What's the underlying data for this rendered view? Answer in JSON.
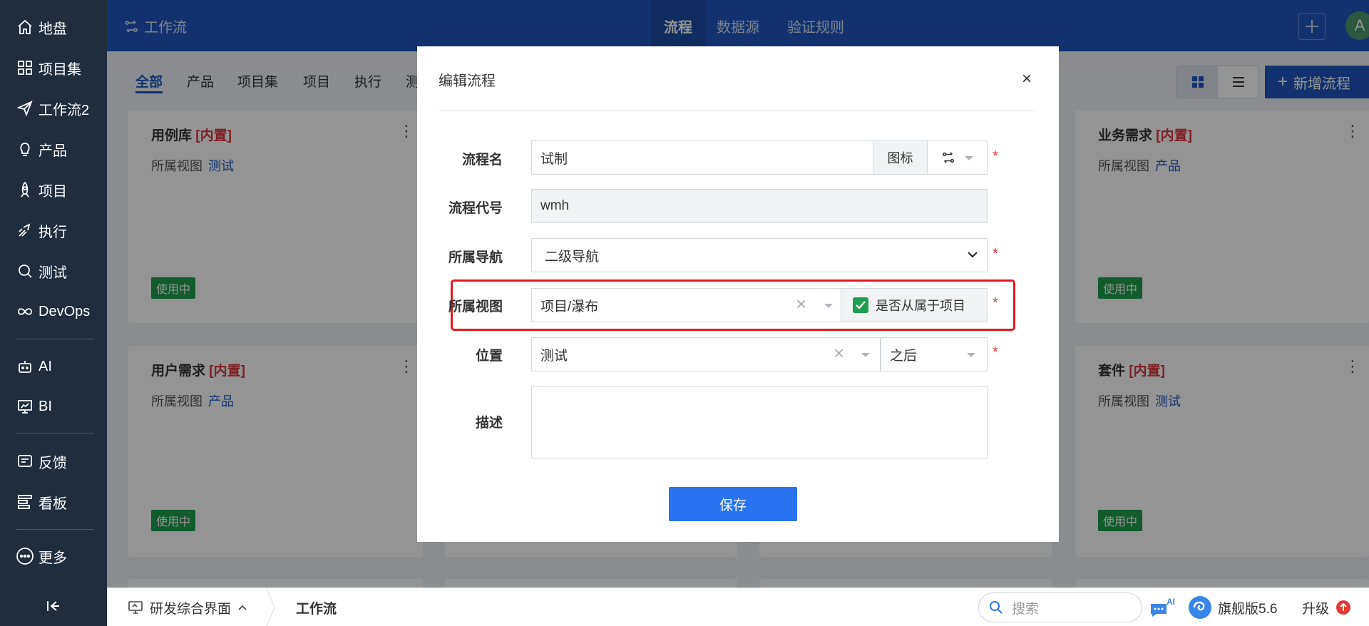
{
  "sidebar": {
    "items": [
      {
        "label": "地盘",
        "icon": "home-icon"
      },
      {
        "label": "项目集",
        "icon": "grid-icon"
      },
      {
        "label": "工作流2",
        "icon": "paper-plane-icon"
      },
      {
        "label": "产品",
        "icon": "lightbulb-icon"
      },
      {
        "label": "项目",
        "icon": "rocket-icon"
      },
      {
        "label": "执行",
        "icon": "run-icon"
      },
      {
        "label": "测试",
        "icon": "magnifier-icon"
      },
      {
        "label": "DevOps",
        "icon": "infinity-icon"
      },
      {
        "label": "AI",
        "icon": "robot-icon"
      },
      {
        "label": "BI",
        "icon": "chart-board-icon"
      },
      {
        "label": "反馈",
        "icon": "feedback-icon"
      },
      {
        "label": "看板",
        "icon": "kanban-icon"
      },
      {
        "label": "更多",
        "icon": "more-icon"
      }
    ]
  },
  "topbar": {
    "title": "工作流",
    "tabs": [
      "流程",
      "数据源",
      "验证规则"
    ],
    "avatar": "A"
  },
  "subtabs": [
    "全部",
    "产品",
    "项目集",
    "项目",
    "执行",
    "测"
  ],
  "toolbar": {
    "new_label": "新增流程"
  },
  "cards": [
    {
      "title": "用例库",
      "builtin": "[内置]",
      "view_label": "所属视图",
      "view": "测试",
      "status": "使用中"
    },
    {
      "title": "用户需求",
      "builtin": "[内置]",
      "view_label": "所属视图",
      "view": "产品",
      "status": "使用中"
    },
    {
      "title": "业务需求",
      "builtin": "[内置]",
      "view_label": "所属视图",
      "view": "产品",
      "status": "使用中"
    },
    {
      "title": "套件",
      "builtin": "[内置]",
      "view_label": "所属视图",
      "view": "测试",
      "status": "使用中"
    }
  ],
  "modal": {
    "title": "编辑流程",
    "close": "×",
    "fields": {
      "name": {
        "label": "流程名",
        "value": "试制",
        "addon": "图标"
      },
      "code": {
        "label": "流程代号",
        "value": "wmh"
      },
      "nav": {
        "label": "所属导航",
        "value": "二级导航"
      },
      "view": {
        "label": "所属视图",
        "value": "项目/瀑布",
        "checkbox_label": "是否从属于项目",
        "checked": true
      },
      "position": {
        "label": "位置",
        "value": "测试",
        "order": "之后"
      },
      "desc": {
        "label": "描述",
        "value": ""
      }
    },
    "required_mark": "*",
    "save_label": "保存"
  },
  "bottombar": {
    "workspace": "研发综合界面",
    "current": "工作流",
    "search_placeholder": "搜索",
    "ai_badge": "AI",
    "edition": "旗舰版5.6",
    "upgrade": "升级"
  },
  "colors": {
    "primary": "#1f57bf",
    "sidebar": "#1f2d3d",
    "danger": "#e5191e",
    "success": "#1e9e4f",
    "save": "#2b73f0"
  }
}
